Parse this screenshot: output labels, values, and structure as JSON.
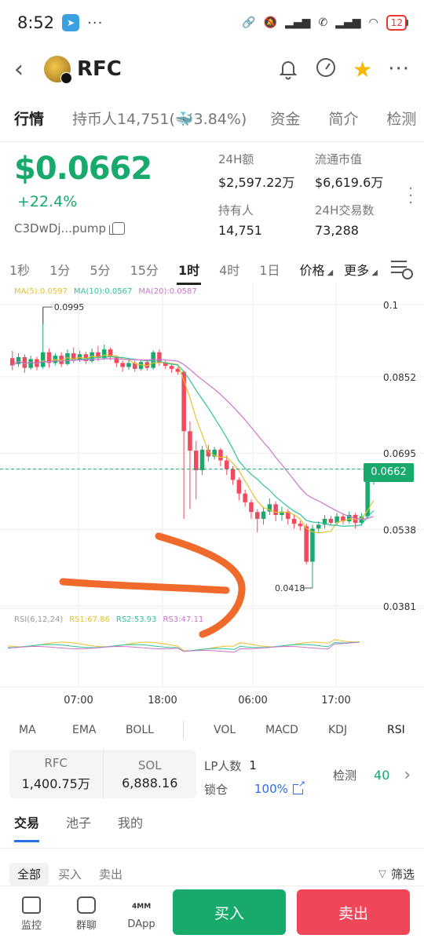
{
  "status_bar": {
    "time": "8:52",
    "battery": "12"
  },
  "header": {
    "token_name": "RFC"
  },
  "main_tabs": [
    {
      "label": "行情"
    },
    {
      "label": "持币人14,751(🐳3.84%)"
    },
    {
      "label": "资金"
    },
    {
      "label": "简介"
    },
    {
      "label": "检测"
    }
  ],
  "price": {
    "value": "$0.0662",
    "change": "+22.4%",
    "contract": "C3DwDj...pump"
  },
  "stats": [
    {
      "label": "24H额",
      "value": "$2,597.22万"
    },
    {
      "label": "流通市值",
      "value": "$6,619.6万"
    },
    {
      "label": "持有人",
      "value": "14,751"
    },
    {
      "label": "24H交易数",
      "value": "73,288"
    }
  ],
  "timeframes": [
    "1秒",
    "1分",
    "5分",
    "15分",
    "1时",
    "4时",
    "1日"
  ],
  "timeframe_active": "1时",
  "timeframe_selects": {
    "price": "价格",
    "more": "更多"
  },
  "chart": {
    "ma_legend": {
      "ma5": "MA(5):0.0597",
      "ma10": "MA(10):0.0567",
      "ma20": "MA(20):0.0587"
    },
    "rsi_legend": {
      "title": "RSI(6,12,24)",
      "rs1": "RS1:67.86",
      "rs2": "RS2:53.93",
      "rs3": "RS3:47.11"
    },
    "y_labels": [
      "0.1",
      "0.0852",
      "0.0695",
      "0.0538",
      "0.0381"
    ],
    "x_labels": [
      "07:00",
      "18:00",
      "06:00",
      "17:00"
    ],
    "high_label": "0.0995",
    "low_label": "0.0418",
    "current_price_tag": "0.0662",
    "colors": {
      "up": "#18a96d",
      "down": "#ef4a5e",
      "ma5": "#e7c12f",
      "ma10": "#2fc39a",
      "ma20": "#cf72cf",
      "annotation": "#f06a2b"
    }
  },
  "indicators_left": [
    "MA",
    "EMA",
    "BOLL"
  ],
  "indicators_right": [
    "VOL",
    "MACD",
    "KDJ",
    "RSI"
  ],
  "pool": [
    {
      "label": "RFC",
      "value": "1,400.75万"
    },
    {
      "label": "SOL",
      "value": "6,888.16"
    }
  ],
  "lp": {
    "count_label": "LP人数",
    "count": "1",
    "lock_label": "锁仓",
    "lock_value": "100%"
  },
  "check": {
    "label": "检测",
    "score": "40"
  },
  "sub_tabs": [
    "交易",
    "池子",
    "我的"
  ],
  "filters": [
    "全部",
    "买入",
    "卖出"
  ],
  "filter_button": "筛选",
  "bottom_nav": [
    {
      "label": "监控"
    },
    {
      "label": "群聊"
    },
    {
      "label": "DApp",
      "badge": "4MM"
    }
  ],
  "actions": {
    "buy": "买入",
    "sell": "卖出"
  }
}
